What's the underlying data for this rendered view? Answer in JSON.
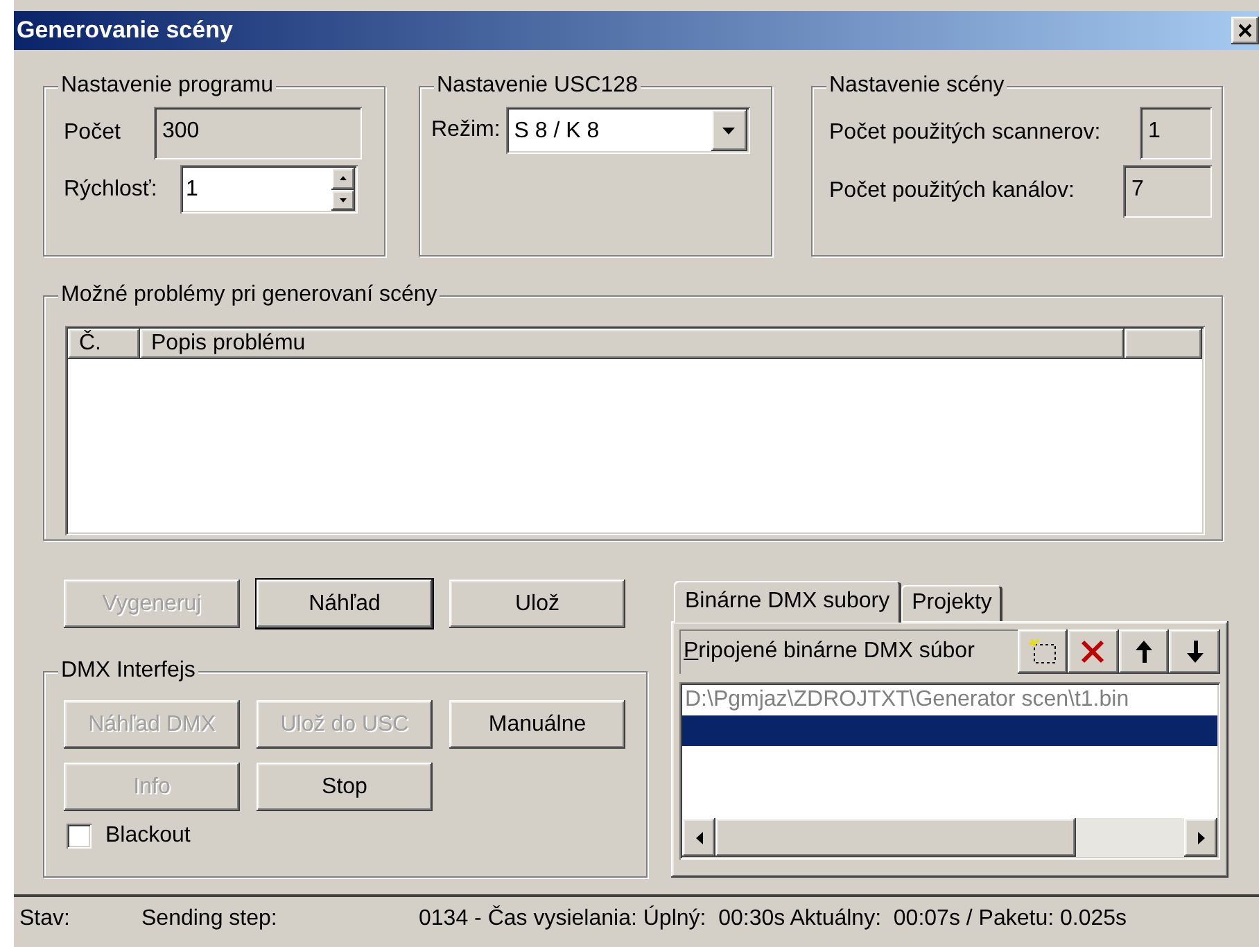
{
  "window": {
    "title": "Generovanie scény"
  },
  "program": {
    "title": "Nastavenie programu",
    "count_label": "Počet",
    "count_value": "300",
    "speed_label": "Rýchlosť:",
    "speed_value": "1"
  },
  "usc": {
    "title": "Nastavenie USC128",
    "mode_label": "Režim:",
    "mode_value": "S 8 / K 8"
  },
  "scene": {
    "title": "Nastavenie scény",
    "scanners_label": "Počet použitých scannerov:",
    "scanners_value": "1",
    "channels_label": "Počet použitých kanálov:",
    "channels_value": "7"
  },
  "problems": {
    "title": "Možné problémy pri generovaní scény",
    "columns": [
      "Č.",
      "Popis problému"
    ]
  },
  "buttons": [
    {
      "label": "Vygeneruj",
      "disabled": true,
      "default": false
    },
    {
      "label": "Náhľad",
      "disabled": false,
      "default": true
    },
    {
      "label": "Ulož",
      "disabled": false,
      "default": false
    }
  ],
  "dmx": {
    "title": "DMX Interfejs",
    "buttons": [
      {
        "label": "Náhľad DMX",
        "disabled": true
      },
      {
        "label": "Ulož do USC",
        "disabled": true
      },
      {
        "label": "Manuálne",
        "disabled": false
      },
      {
        "label": "Info",
        "disabled": true
      },
      {
        "label": "Stop",
        "disabled": false
      }
    ],
    "blackout": {
      "label": "Blackout",
      "checked": false
    }
  },
  "tabs": [
    {
      "label": "Binárne DMX subory",
      "selected": true
    },
    {
      "label": "Projekty",
      "selected": false
    }
  ],
  "files": {
    "label": "Pripojené binárne DMX súbor",
    "rows": [
      {
        "text": "D:\\Pgmjaz\\ZDROJTXT\\Generator scen\\t1.bin",
        "selected": false
      },
      {
        "selected": true
      }
    ]
  },
  "status": [
    "Stav:",
    "Sending step:",
    "0134 - Čas vysielania: Úplný:  00:30s Aktuálny:  00:07s / Paketu: 0.025s"
  ]
}
